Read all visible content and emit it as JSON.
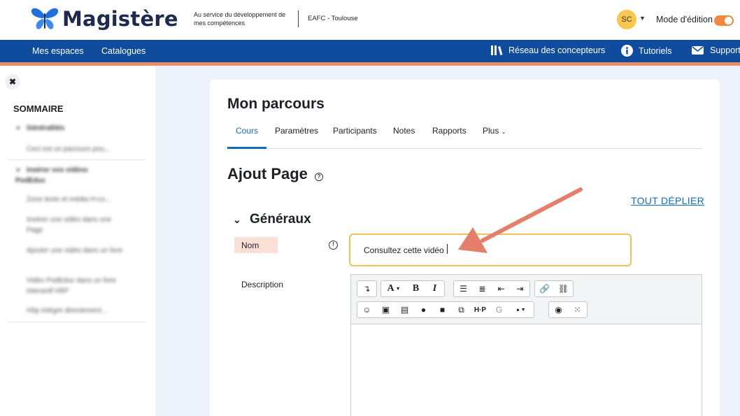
{
  "header": {
    "logo_text": "Magistère",
    "tagline": "Au service du développement de mes compétences",
    "org": "EAFC - Toulouse",
    "avatar_initials": "SC",
    "edit_mode_label": "Mode d'édition",
    "edit_mode_on": true
  },
  "nav": {
    "items": [
      "Mes espaces",
      "Catalogues"
    ],
    "right_items": [
      {
        "label": "Réseau des concepteurs",
        "icon": "library-icon"
      },
      {
        "label": "Tutoriels",
        "icon": "info-icon"
      },
      {
        "label": "Support",
        "icon": "mail-icon"
      }
    ]
  },
  "sidebar": {
    "title": "SOMMAIRE",
    "sections": [
      {
        "label": "Généralités",
        "items": [
          "Ceci est un parcours pou..."
        ]
      },
      {
        "label": "Insérer vos vidéos PodEduc",
        "items": [
          "Zone texte et média H-co...",
          "Insérer une vidéo dans une Page",
          "Ajouter une vidéo dans un livre",
          "Vidéo PodEduc dans un livre interactif H5P",
          "H5p intégré directement..."
        ]
      }
    ]
  },
  "main": {
    "page_title": "Mon parcours",
    "tabs": [
      "Cours",
      "Paramètres",
      "Participants",
      "Notes",
      "Rapports",
      "Plus"
    ],
    "active_tab": "Cours",
    "heading": "Ajout Page",
    "expand_all": "TOUT DÉPLIER",
    "section_title": "Généraux",
    "name_label": "Nom",
    "name_value": "Consultez cette vidéo",
    "description_label": "Description"
  },
  "colors": {
    "brand_dark": "#1d2a4e",
    "nav_blue": "#0f4c9e",
    "accent_orange": "#ec8b68",
    "link_blue": "#0f6cbf",
    "input_focus": "#f2c057",
    "annotation_arrow": "#e57e6a"
  }
}
